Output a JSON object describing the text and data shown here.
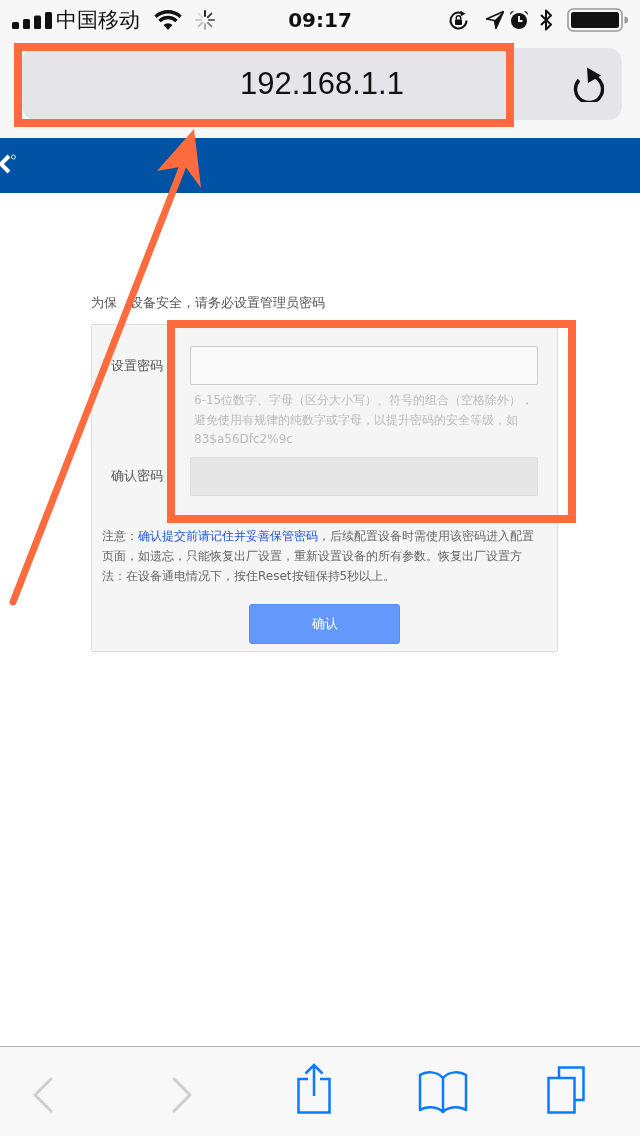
{
  "status_bar": {
    "carrier": "中国移动",
    "time": "09:17"
  },
  "address_bar": {
    "url": "192.168.1.1",
    "highlighted": true
  },
  "page": {
    "intro": [
      "为保",
      "设备安全，请务必设置管理员密码"
    ],
    "fields": [
      {
        "label": "设置密码",
        "disabled": false,
        "hint": "6-15位数字、字母（区分大小写）、符号的组合（空格除外），避免使用有规律的纯数字或字母，以提升密码的安全等级，如83$a56Dfc2%9c"
      },
      {
        "label": "确认密码",
        "disabled": true
      }
    ],
    "fields_highlighted": true,
    "note": {
      "lead": "注意：",
      "link": "确认提交前请记住并妥善保管密码",
      "rest": "，后续配置设备时需使用该密码进入配置页面，如遗忘，只能恢复出厂设置，重新设置设备的所有参数。恢复出厂设置方法：在设备通电情况下，按住Reset按钮保持5秒以上。"
    },
    "button": "确认"
  },
  "toolbar": [
    {
      "kind": "back",
      "disabled": true
    },
    {
      "kind": "forward",
      "disabled": true
    },
    {
      "kind": "share",
      "disabled": false
    },
    {
      "kind": "bookmarks",
      "disabled": false
    },
    {
      "kind": "tabs",
      "disabled": false
    }
  ],
  "annotation_arrow": true
}
